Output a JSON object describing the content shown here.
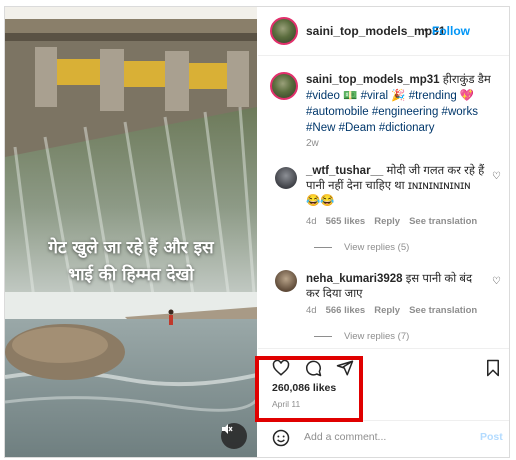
{
  "post": {
    "username": "saini_top_models_mp31",
    "follow_label": "Follow",
    "dot": "•",
    "overlay_text_line1": "गेट खुले जा रहे हैं और इस",
    "overlay_text_line2": "भाई की हिम्मत देखो",
    "caption": {
      "username": "saini_top_models_mp31",
      "text_before_tags": " हीराकुंड डैम ",
      "tags_line": "#video 💵 #viral 🎉 #trending 💖 #automobile #engineering #works #New #Deam #dictionary",
      "time": "2w"
    }
  },
  "comments": [
    {
      "username": "_wtf_tushar__",
      "text": " मोदी जी गलत कर रहे हैं पानी नहीं देना चाहिए था ɪɴɪɴɪɴɪɴɪɴɪɴ",
      "emojis": "😂😂",
      "time": "4d",
      "likes": "565 likes",
      "reply": "Reply",
      "translate": "See translation",
      "view_replies": "View replies (5)"
    },
    {
      "username": "neha_kumari3928",
      "text": " इस पानी को बंद कर दिया जाए",
      "time": "4d",
      "likes": "566 likes",
      "reply": "Reply",
      "translate": "See translation",
      "view_replies": "View replies (7)"
    }
  ],
  "actions": {
    "likes": "260,086 likes",
    "date": "April 11",
    "heart_icon": "heart-icon",
    "comment_icon": "comment-icon",
    "share_icon": "share-icon",
    "save_icon": "bookmark-icon"
  },
  "comment_box": {
    "placeholder": "Add a comment...",
    "post_label": "Post"
  },
  "colors": {
    "follow": "#0095f6",
    "hashtag": "#00376b",
    "muted": "#8e8e8e",
    "highlight": "#e00000",
    "post_disabled": "#b3dbff"
  }
}
